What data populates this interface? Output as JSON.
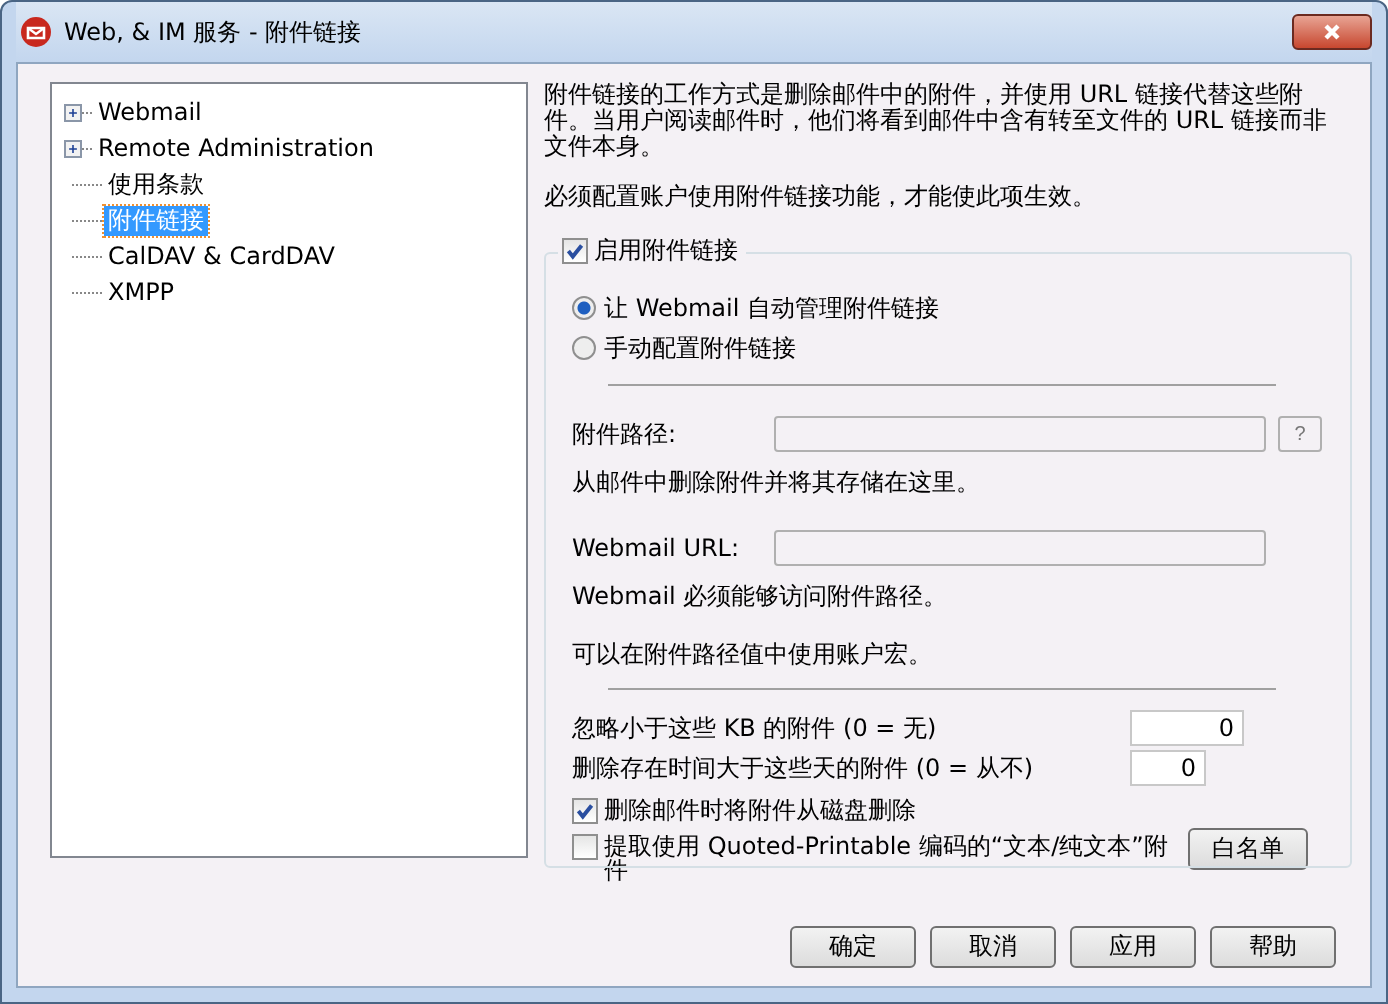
{
  "window": {
    "title": "Web, & IM 服务 - 附件链接"
  },
  "tree": [
    {
      "label": "Webmail",
      "expanded": false,
      "selected": false
    },
    {
      "label": "Remote Administration",
      "expanded": false,
      "selected": false
    },
    {
      "label": "使用条款",
      "selected": false
    },
    {
      "label": "附件链接",
      "selected": true
    },
    {
      "label": "CalDAV & CardDAV",
      "selected": false
    },
    {
      "label": "XMPP",
      "selected": false
    }
  ],
  "intro": "附件链接的工作方式是删除邮件中的附件，并使用 URL 链接代替这些附件。当用户阅读邮件时，他们将看到邮件中含有转至文件的 URL 链接而非文件本身。",
  "note": "必须配置账户使用附件链接功能，才能使此项生效。",
  "enable": {
    "label": "启用附件链接",
    "checked": true
  },
  "modes": [
    {
      "label": "让 Webmail 自动管理附件链接",
      "selected": true
    },
    {
      "label": "手动配置附件链接",
      "selected": false
    }
  ],
  "path_field": {
    "label": "附件路径:",
    "help": "?",
    "hint": "从邮件中删除附件并将其存储在这里。"
  },
  "url_field": {
    "label": "Webmail URL:",
    "hint": "Webmail 必须能够访问附件路径。"
  },
  "macro_note": "可以在附件路径值中使用账户宏。",
  "numbers": [
    {
      "label": "忽略小于这些 KB 的附件 (0 = 无)",
      "value": "0"
    },
    {
      "label": "删除存在时间大于这些天的附件 (0 = 从不)",
      "value": "0"
    }
  ],
  "options": [
    {
      "label": "删除邮件时将附件从磁盘删除",
      "checked": true
    },
    {
      "label": "提取使用 Quoted-Printable 编码的“文本/纯文本”附件",
      "checked": false
    }
  ],
  "whitelist_button": "白名单",
  "buttons": [
    "确定",
    "取消",
    "应用",
    "帮助"
  ]
}
